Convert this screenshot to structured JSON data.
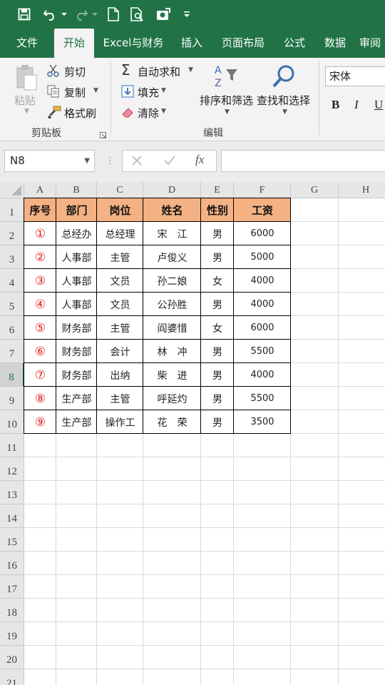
{
  "ribbon_tabs": [
    "文件",
    "开始",
    "Excel与财务",
    "插入",
    "页面布局",
    "公式",
    "数据",
    "审阅"
  ],
  "ribbon": {
    "paste": "粘贴",
    "cut": "剪切",
    "copy": "复制",
    "format_painter": "格式刷",
    "clipboard_group": "剪贴板",
    "autosum": "自动求和",
    "fill": "填充",
    "clear": "清除",
    "sort_filter": "排序和筛选",
    "find_select": "查找和选择",
    "editing_group": "编辑",
    "font_name": "宋体",
    "bold": "B",
    "italic": "I",
    "underline": "U"
  },
  "formula_bar": {
    "name_box": "N8",
    "fx": "fx",
    "value": ""
  },
  "columns": [
    "A",
    "B",
    "C",
    "D",
    "E",
    "F",
    "G",
    "H"
  ],
  "rows": [
    "1",
    "2",
    "3",
    "4",
    "5",
    "6",
    "7",
    "8",
    "9",
    "10",
    "11",
    "12",
    "13",
    "14",
    "15",
    "16",
    "17",
    "18",
    "19",
    "20",
    "21"
  ],
  "selected_row": "8",
  "table": {
    "headers": [
      "序号",
      "部门",
      "岗位",
      "姓名",
      "性别",
      "工资"
    ],
    "rows": [
      [
        "①",
        "总经办",
        "总经理",
        "宋　江",
        "男",
        "6000"
      ],
      [
        "②",
        "人事部",
        "主管",
        "卢俊义",
        "男",
        "5000"
      ],
      [
        "③",
        "人事部",
        "文员",
        "孙二娘",
        "女",
        "4000"
      ],
      [
        "④",
        "人事部",
        "文员",
        "公孙胜",
        "男",
        "4000"
      ],
      [
        "⑤",
        "财务部",
        "主管",
        "阎婆惜",
        "女",
        "6000"
      ],
      [
        "⑥",
        "财务部",
        "会计",
        "林　冲",
        "男",
        "5500"
      ],
      [
        "⑦",
        "财务部",
        "出纳",
        "柴　进",
        "男",
        "4000"
      ],
      [
        "⑧",
        "生产部",
        "主管",
        "呼延灼",
        "男",
        "5500"
      ],
      [
        "⑨",
        "生产部",
        "操作工",
        "花　荣",
        "男",
        "3500"
      ]
    ]
  },
  "colors": {
    "excel_green": "#217346",
    "header_fill": "#f4b183",
    "number_red": "#e02020"
  }
}
